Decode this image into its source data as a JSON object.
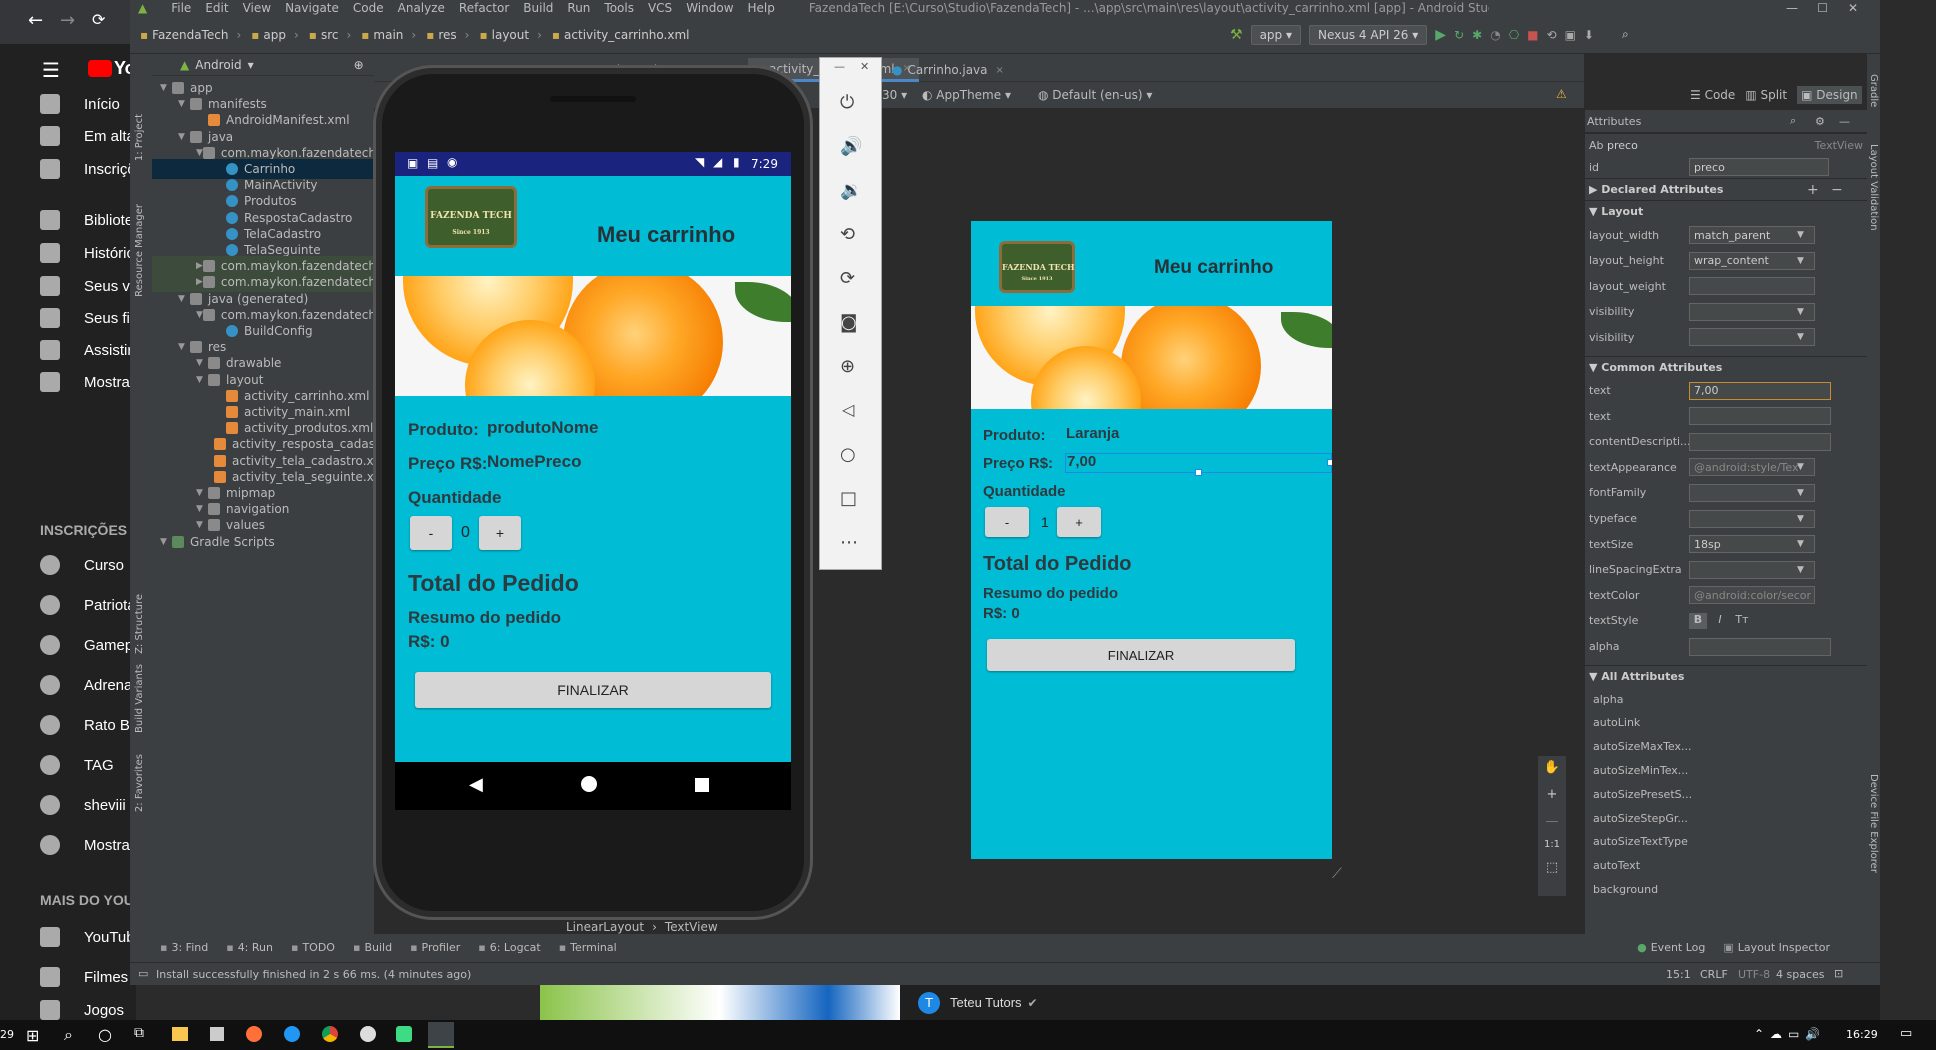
{
  "youtube": {
    "logo": "Yo",
    "nav": [
      "Início",
      "Em alta",
      "Inscrições",
      "Biblioteca",
      "Histórico",
      "Seus vídeos",
      "Seus filmes",
      "Assistir mais tarde",
      "Mostrar mais"
    ],
    "subs_header": "INSCRIÇÕES",
    "subs": [
      "Curso",
      "Patriota",
      "Gamepl",
      "Adrena",
      "Rato B",
      "TAG",
      "sheviii",
      "Mostrar"
    ],
    "more_header": "MAIS DO YOUTUBE",
    "more": [
      "YouTube",
      "Filmes",
      "Jogos"
    ]
  },
  "menubar": {
    "items": [
      "File",
      "Edit",
      "View",
      "Navigate",
      "Code",
      "Analyze",
      "Refactor",
      "Build",
      "Run",
      "Tools",
      "VCS",
      "Window",
      "Help"
    ],
    "title": "FazendaTech [E:\\Curso\\Studio\\FazendaTech] - ...\\app\\src\\main\\res\\layout\\activity_carrinho.xml [app] - Android Studio"
  },
  "navbar": {
    "crumbs": [
      "FazendaTech",
      "app",
      "src",
      "main",
      "res",
      "layout",
      "activity_carrinho.xml"
    ],
    "run_config": "app",
    "device": "Nexus 4 API 26"
  },
  "project": {
    "view": "Android",
    "tree": [
      {
        "label": "app",
        "depth": 0,
        "icon": "folder"
      },
      {
        "label": "manifests",
        "depth": 1,
        "icon": "folder"
      },
      {
        "label": "AndroidManifest.xml",
        "depth": 2,
        "icon": "xml"
      },
      {
        "label": "java",
        "depth": 1,
        "icon": "folder"
      },
      {
        "label": "com.maykon.fazendatech",
        "depth": 2,
        "icon": "package"
      },
      {
        "label": "Carrinho",
        "depth": 3,
        "icon": "class",
        "selected": true
      },
      {
        "label": "MainActivity",
        "depth": 3,
        "icon": "class"
      },
      {
        "label": "Produtos",
        "depth": 3,
        "icon": "class"
      },
      {
        "label": "RespostaCadastro",
        "depth": 3,
        "icon": "class"
      },
      {
        "label": "TelaCadastro",
        "depth": 3,
        "icon": "class"
      },
      {
        "label": "TelaSeguinte",
        "depth": 3,
        "icon": "class"
      },
      {
        "label": "com.maykon.fazendatech (",
        "depth": 2,
        "icon": "package",
        "hl": true
      },
      {
        "label": "com.maykon.fazendatech (",
        "depth": 2,
        "icon": "package",
        "hl": true
      },
      {
        "label": "java (generated)",
        "depth": 1,
        "icon": "folder"
      },
      {
        "label": "com.maykon.fazendatech",
        "depth": 2,
        "icon": "package"
      },
      {
        "label": "BuildConfig",
        "depth": 3,
        "icon": "class"
      },
      {
        "label": "res",
        "depth": 1,
        "icon": "folder"
      },
      {
        "label": "drawable",
        "depth": 2,
        "icon": "folder"
      },
      {
        "label": "layout",
        "depth": 2,
        "icon": "folder"
      },
      {
        "label": "activity_carrinho.xml",
        "depth": 3,
        "icon": "layout"
      },
      {
        "label": "activity_main.xml",
        "depth": 3,
        "icon": "layout"
      },
      {
        "label": "activity_produtos.xml",
        "depth": 3,
        "icon": "layout"
      },
      {
        "label": "activity_resposta_cadastr",
        "depth": 3,
        "icon": "layout"
      },
      {
        "label": "activity_tela_cadastro.xm",
        "depth": 3,
        "icon": "layout"
      },
      {
        "label": "activity_tela_seguinte.xm",
        "depth": 3,
        "icon": "layout"
      },
      {
        "label": "mipmap",
        "depth": 2,
        "icon": "folder"
      },
      {
        "label": "navigation",
        "depth": 2,
        "icon": "folder"
      },
      {
        "label": "values",
        "depth": 2,
        "icon": "folder"
      },
      {
        "label": "Gradle Scripts",
        "depth": 0,
        "icon": "gradle"
      }
    ]
  },
  "side_tools": {
    "left": [
      "1: Project",
      "Resource Manager",
      "Z: Structure",
      "Build Variants",
      "2: Favorites"
    ],
    "right": [
      "Gradle",
      "Layout Validation",
      "Device File Explorer"
    ]
  },
  "tabs": [
    "ular.xml",
    "va",
    "activity_carrinho.xml",
    "Carrinho.java"
  ],
  "designbar": {
    "api": "30",
    "theme": "AppTheme",
    "locale": "Default (en-us)",
    "modes": [
      "Code",
      "Split",
      "Design"
    ]
  },
  "emulator": {
    "time": "7:29",
    "app_title": "Meu carrinho",
    "logo_text": "FAZENDA TECH",
    "logo_sub": "Since 1913",
    "produto_label": "Produto:",
    "produto_value": "produtoNome",
    "preco_label": "Preço R$:",
    "preco_value": "NomePreco",
    "quantidade_label": "Quantidade",
    "minus": "-",
    "qty": "0",
    "plus": "+",
    "total_title": "Total do Pedido",
    "resumo": "Resumo do pedido",
    "total_value": "R$: 0",
    "finalizar": "FINALIZAR"
  },
  "preview": {
    "app_title": "Meu carrinho",
    "logo_text": "FAZENDA TECH",
    "logo_sub": "Since 1913",
    "produto_label": "Produto:",
    "produto_value": "Laranja",
    "preco_label": "Preço R$:",
    "preco_value": "7,00",
    "quantidade_label": "Quantidade",
    "minus": "-",
    "qty": "1",
    "plus": "+",
    "total_title": "Total do Pedido",
    "resumo": "Resumo do pedido",
    "total_value": "R$: 0",
    "finalizar": "FINALIZAR"
  },
  "breadcrumb": [
    "LinearLayout",
    "TextView"
  ],
  "attributes": {
    "title": "Attributes",
    "widget_type": "Ab",
    "widget_name": "preco",
    "widget_class": "TextView",
    "id_label": "id",
    "id_value": "preco",
    "declared": "Declared Attributes",
    "layout_header": "Layout",
    "layout": [
      {
        "label": "layout_width",
        "value": "match_parent"
      },
      {
        "label": "layout_height",
        "value": "wrap_content"
      },
      {
        "label": "layout_weight",
        "value": ""
      },
      {
        "label": "visibility",
        "value": ""
      },
      {
        "label": "visibility",
        "value": ""
      }
    ],
    "common_header": "Common Attributes",
    "common": [
      {
        "label": "text",
        "value": "7,00"
      },
      {
        "label": "text",
        "value": ""
      },
      {
        "label": "contentDescripti...",
        "value": ""
      },
      {
        "label": "textAppearance",
        "value": "@android:style/Tex"
      },
      {
        "label": "fontFamily",
        "value": ""
      },
      {
        "label": "typeface",
        "value": ""
      },
      {
        "label": "textSize",
        "value": "18sp"
      },
      {
        "label": "lineSpacingExtra",
        "value": ""
      },
      {
        "label": "textColor",
        "value": "@android:color/secor"
      },
      {
        "label": "textStyle",
        "value": ""
      },
      {
        "label": "alpha",
        "value": ""
      }
    ],
    "all_header": "All Attributes",
    "all": [
      "alpha",
      "autoLink",
      "autoSizeMaxTex...",
      "autoSizeMinTex...",
      "autoSizePresetS...",
      "autoSizeStepGr...",
      "autoSizeTextType",
      "autoText",
      "background"
    ]
  },
  "bottom_tools": {
    "left": [
      "3: Find",
      "4: Run",
      "TODO",
      "Build",
      "Profiler",
      "6: Logcat",
      "Terminal"
    ],
    "right": [
      "Event Log",
      "Layout Inspector"
    ]
  },
  "status": {
    "message": "Install successfully finished in 2 s 66 ms. (4 minutes ago)",
    "position": "15:1",
    "line_sep": "CRLF",
    "encoding": "UTF-8",
    "indent": "4 spaces"
  },
  "overlay_text": "Teteu Tutors",
  "taskbar": {
    "time": "16:29",
    "left_num": "29"
  },
  "colors": {
    "app_bg": "#00bcd4",
    "ide_panel": "#3c3f41",
    "ide_editor": "#2b2b2b",
    "selection": "#0d293e"
  }
}
